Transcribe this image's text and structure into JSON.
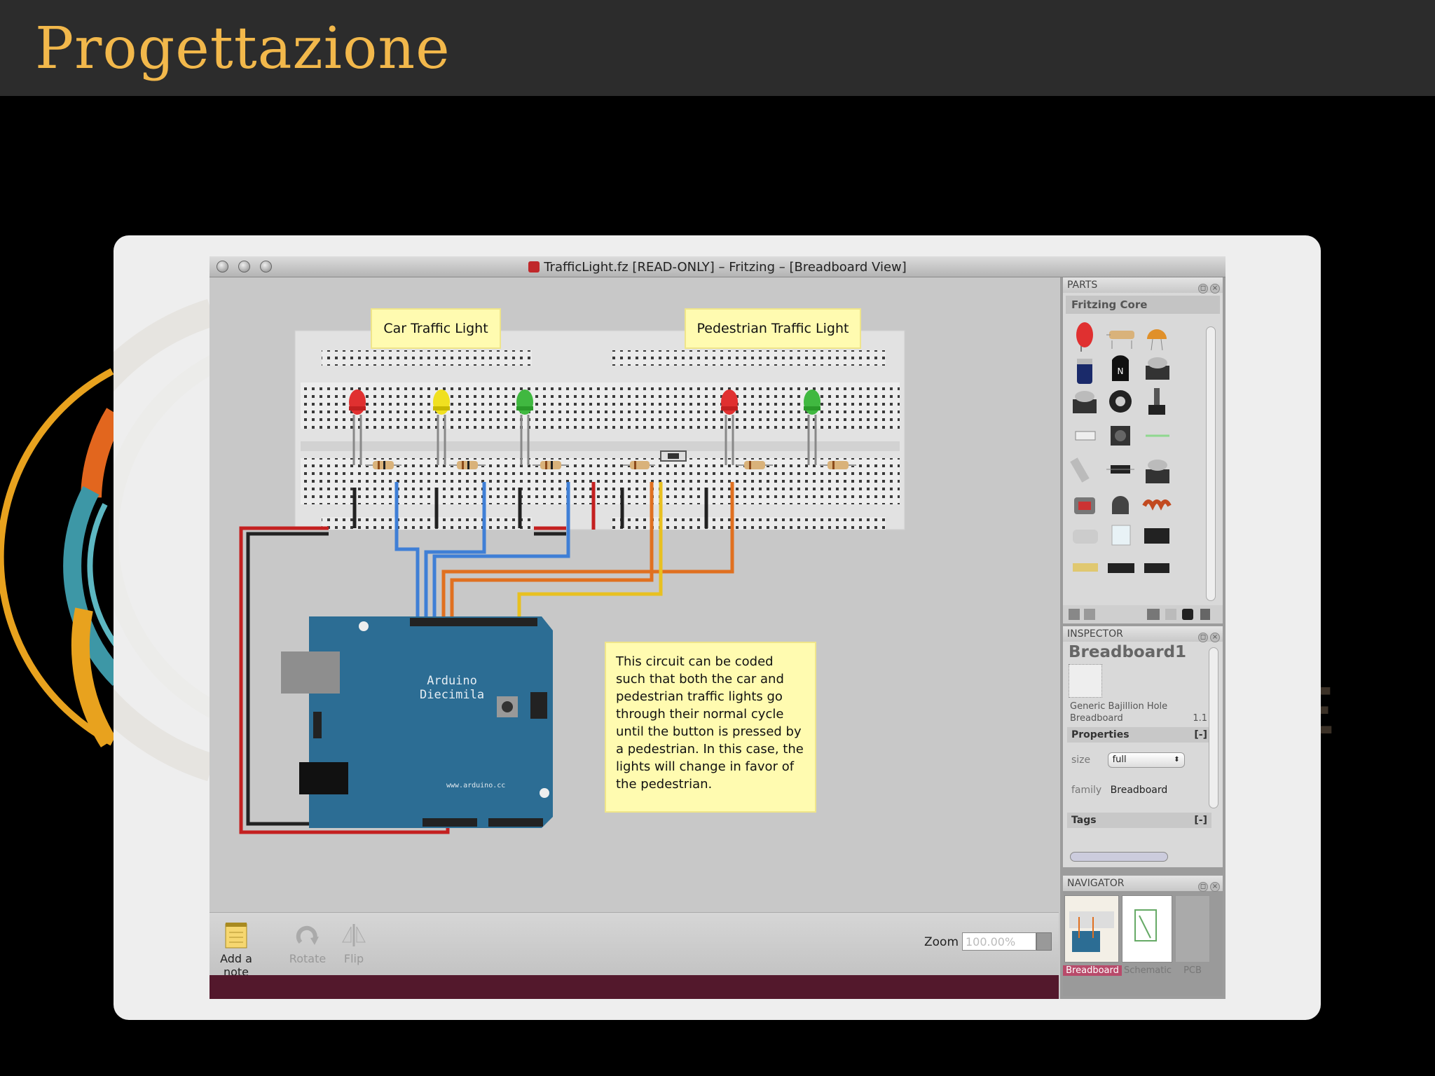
{
  "slide": {
    "title": "Progettazione"
  },
  "window": {
    "title": "TrafficLight.fz [READ-ONLY]  – Fritzing – [Breadboard View]"
  },
  "notes": {
    "car": "Car Traffic Light",
    "pedestrian": "Pedestrian Traffic Light",
    "description": "This circuit can be coded such that both the car and pedestrian traffic lights go through their normal cycle until the button is pressed by a pedestrian. In this case, the lights will change in favor of the pedestrian."
  },
  "board": {
    "name_line1": "Arduino",
    "name_line2": "Diecimila",
    "url": "www.arduino.cc"
  },
  "toolbar": {
    "add_note": "Add a note",
    "rotate": "Rotate",
    "flip": "Flip",
    "zoom_label": "Zoom",
    "zoom_value": "100.00%"
  },
  "parts": {
    "header": "PARTS",
    "bin_title": "Fritzing Core"
  },
  "inspector": {
    "header": "INSPECTOR",
    "title": "Breadboard1",
    "description": "Generic Bajillion Hole Breadboard",
    "version": "1.1",
    "properties_label": "Properties",
    "size_label": "size",
    "size_value": "full",
    "family_label": "family",
    "family_value": "Breadboard",
    "tags_label": "Tags",
    "toggle": "[-]"
  },
  "navigator": {
    "header": "NAVIGATOR",
    "views": [
      "Breadboard",
      "Schematic",
      "PCB"
    ]
  },
  "colors": {
    "accent": "#f2b84b",
    "status_bar": "#53182c",
    "note": "#fffbb0"
  }
}
